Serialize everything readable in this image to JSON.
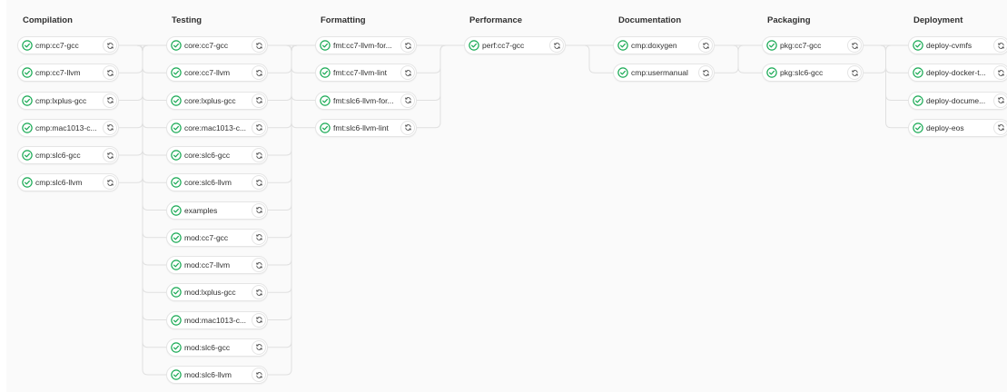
{
  "colors": {
    "success": "#1aaa55",
    "connector": "#e0e0e0",
    "text": "#303030",
    "background": "#fafafa"
  },
  "icons": {
    "status": "status-success-icon",
    "action": "retry-icon"
  },
  "stages": [
    {
      "title": "Compilation",
      "jobs": [
        "cmp:cc7-gcc",
        "cmp:cc7-llvm",
        "cmp:lxplus-gcc",
        "cmp:mac1013-c...",
        "cmp:slc6-gcc",
        "cmp:slc6-llvm"
      ]
    },
    {
      "title": "Testing",
      "jobs": [
        "core:cc7-gcc",
        "core:cc7-llvm",
        "core:lxplus-gcc",
        "core:mac1013-c...",
        "core:slc6-gcc",
        "core:slc6-llvm",
        "examples",
        "mod:cc7-gcc",
        "mod:cc7-llvm",
        "mod:lxplus-gcc",
        "mod:mac1013-c...",
        "mod:slc6-gcc",
        "mod:slc6-llvm"
      ]
    },
    {
      "title": "Formatting",
      "jobs": [
        "fmt:cc7-llvm-for...",
        "fmt:cc7-llvm-lint",
        "fmt:slc6-llvm-for...",
        "fmt:slc6-llvm-lint"
      ]
    },
    {
      "title": "Performance",
      "jobs": [
        "perf:cc7-gcc"
      ]
    },
    {
      "title": "Documentation",
      "jobs": [
        "cmp:doxygen",
        "cmp:usermanual"
      ]
    },
    {
      "title": "Packaging",
      "jobs": [
        "pkg:cc7-gcc",
        "pkg:slc6-gcc"
      ]
    },
    {
      "title": "Deployment",
      "jobs": [
        "deploy-cvmfs",
        "deploy-docker-t...",
        "deploy-docume...",
        "deploy-eos"
      ]
    }
  ]
}
